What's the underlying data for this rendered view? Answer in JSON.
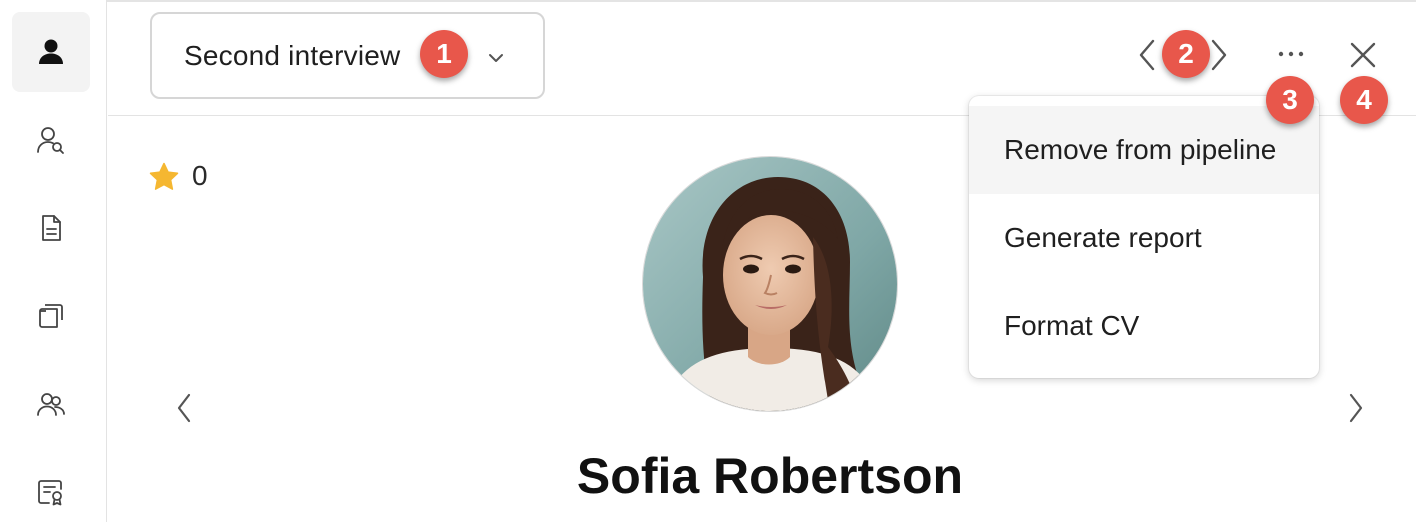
{
  "sidebar": {
    "items": [
      {
        "icon": "user-solid-icon",
        "active": true
      },
      {
        "icon": "user-search-icon",
        "active": false
      },
      {
        "icon": "document-icon",
        "active": false
      },
      {
        "icon": "folders-icon",
        "active": false
      },
      {
        "icon": "users-icon",
        "active": false
      },
      {
        "icon": "certificate-icon",
        "active": false
      }
    ]
  },
  "header": {
    "stage": "Second interview",
    "annotations": [
      "1",
      "2",
      "3",
      "4"
    ]
  },
  "profile": {
    "rating": "0",
    "name": "Sofia Robertson"
  },
  "menu": {
    "items": [
      "Remove from pipeline",
      "Generate report",
      "Format CV"
    ]
  },
  "colors": {
    "badge": "#e8574b",
    "star": "#f5b731"
  }
}
